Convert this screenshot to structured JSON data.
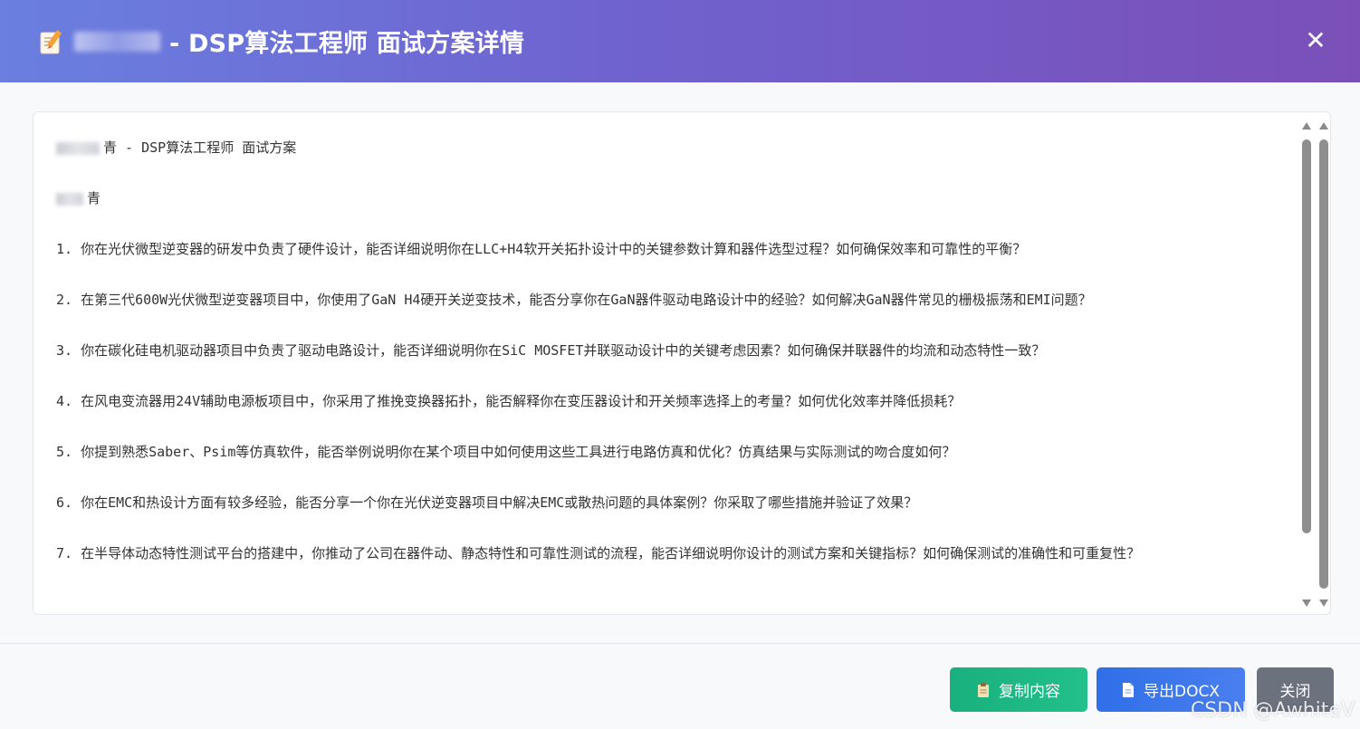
{
  "header": {
    "title": "- DSP算法工程师 面试方案详情",
    "icon": "memo-pencil-icon",
    "close_symbol": "✕"
  },
  "content": {
    "title_line": "- DSP算法工程师 面试方案",
    "name_line_suffix": "青",
    "title_line_prefix_char": "青",
    "questions": [
      "1. 你在光伏微型逆变器的研发中负责了硬件设计，能否详细说明你在LLC+H4软开关拓扑设计中的关键参数计算和器件选型过程？如何确保效率和可靠性的平衡？",
      "2. 在第三代600W光伏微型逆变器项目中，你使用了GaN H4硬开关逆变技术，能否分享你在GaN器件驱动电路设计中的经验？如何解决GaN器件常见的栅极振荡和EMI问题？",
      "3. 你在碳化硅电机驱动器项目中负责了驱动电路设计，能否详细说明你在SiC MOSFET并联驱动设计中的关键考虑因素？如何确保并联器件的均流和动态特性一致？",
      "4. 在风电变流器用24V辅助电源板项目中，你采用了推挽变换器拓扑，能否解释你在变压器设计和开关频率选择上的考量？如何优化效率并降低损耗？",
      "5. 你提到熟悉Saber、Psim等仿真软件，能否举例说明你在某个项目中如何使用这些工具进行电路仿真和优化？仿真结果与实际测试的吻合度如何？",
      "6. 你在EMC和热设计方面有较多经验，能否分享一个你在光伏逆变器项目中解决EMC或散热问题的具体案例？你采取了哪些措施并验证了效果？",
      "7. 在半导体动态特性测试平台的搭建中，你推动了公司在器件动、静态特性和可靠性测试的流程，能否详细说明你设计的测试方案和关键指标？如何确保测试的准确性和可重复性？"
    ]
  },
  "footer": {
    "copy_label": "复制内容",
    "export_label": "导出DOCX",
    "close_label": "关闭"
  },
  "watermark": "CSDN @AwhiteV",
  "colors": {
    "header_start": "#6a7fe0",
    "header_end": "#7b4fb8",
    "copy_button": "#19b07e",
    "export_button": "#2f6fe8",
    "close_button": "#6b717d"
  }
}
